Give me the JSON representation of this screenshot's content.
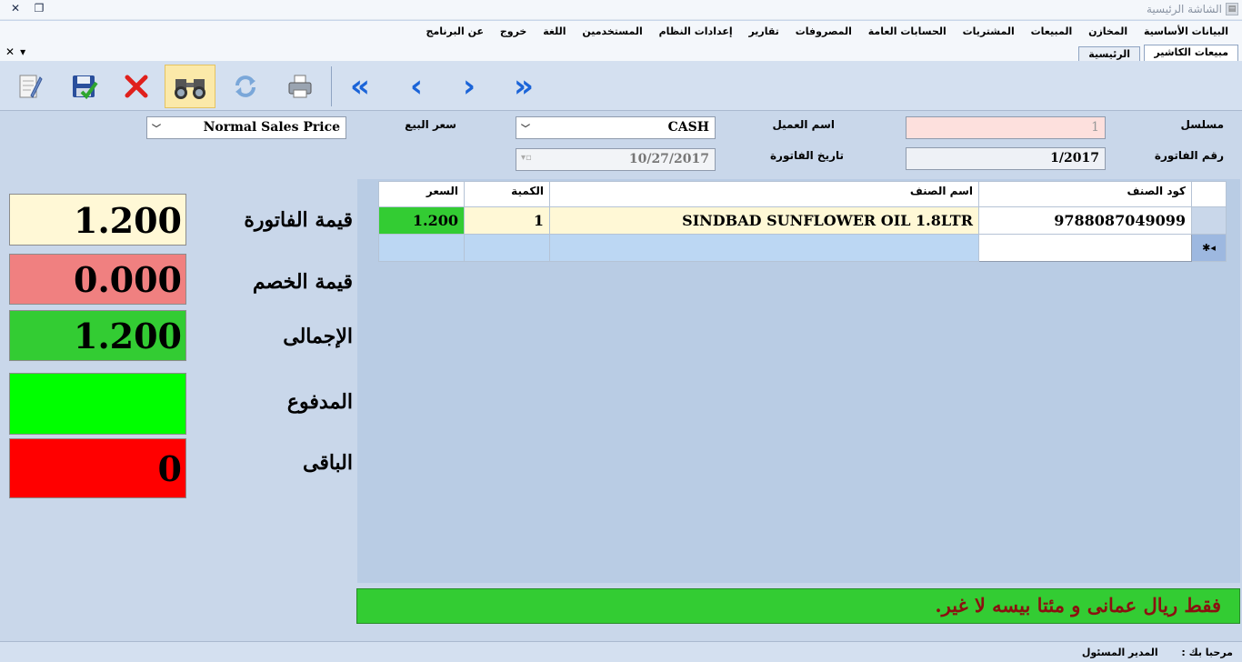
{
  "window": {
    "title": "الشاشة الرئيسية",
    "app_icon": "app-icon",
    "restore_glyph": "❐",
    "close_glyph": "✕"
  },
  "menu": [
    "البيانات الأساسية",
    "المخازن",
    "المبيعات",
    "المشتريات",
    "الحسابات العامة",
    "المصروفات",
    "تقارير",
    "إعدادات النظام",
    "المستخدمين",
    "اللغة",
    "خروج",
    "عن البرنامج"
  ],
  "tabs": {
    "active": "مبيعات الكاشير",
    "other": "الرئيسية",
    "close_glyph": "✕",
    "pin_glyph": "▾"
  },
  "toolbar": {
    "icons": [
      "edit-icon",
      "save-icon",
      "delete-icon",
      "search-icon",
      "refresh-icon",
      "print-icon"
    ],
    "nav": {
      "first": "«",
      "prev": "‹",
      "next": "›",
      "last": "»"
    }
  },
  "form": {
    "serial_label": "مسلسل",
    "serial_value": "1",
    "invoice_no_label": "رقم الفاتورة",
    "invoice_no_value": "1/2017",
    "customer_label": "اسم العميل",
    "customer_value": "CASH",
    "invoice_date_label": "تاريخ الفاتورة",
    "invoice_date_value": "10/27/2017",
    "price_type_label": "سعر البيع",
    "price_type_value": "Normal Sales Price"
  },
  "grid": {
    "columns": [
      "كود الصنف",
      "اسم الصنف",
      "الكمية",
      "السعر"
    ],
    "rows": [
      {
        "code": "9788087049099",
        "name": "SINDBAD SUNFLOWER OIL 1.8LTR",
        "qty": "1",
        "price": "1.200"
      }
    ],
    "new_row_marker": "✱◂"
  },
  "totals": {
    "invoice_value_label": "قيمة الفاتورة",
    "invoice_value": "1.200",
    "discount_label": "قيمة الخصم",
    "discount_value": "0.000",
    "total_label": "الإجمالى",
    "total_value": "1.200",
    "paid_label": "المدفوع",
    "paid_value": "",
    "remaining_label": "الباقى",
    "remaining_value": "0"
  },
  "banner_text": "فقط ريال عمانى و مئتا بيسه لا غير.",
  "status": {
    "welcome_label": "مرحبا بك :",
    "user_name": "المدير المسئول"
  },
  "colors": {
    "invoice_value_bg": "#fff8d6",
    "discount_bg": "#f08080",
    "total_bg": "#33cc33",
    "paid_bg": "#00ff00",
    "remaining_bg": "#ff0000",
    "banner_bg": "#33cc33",
    "banner_text": "#8b1010"
  }
}
